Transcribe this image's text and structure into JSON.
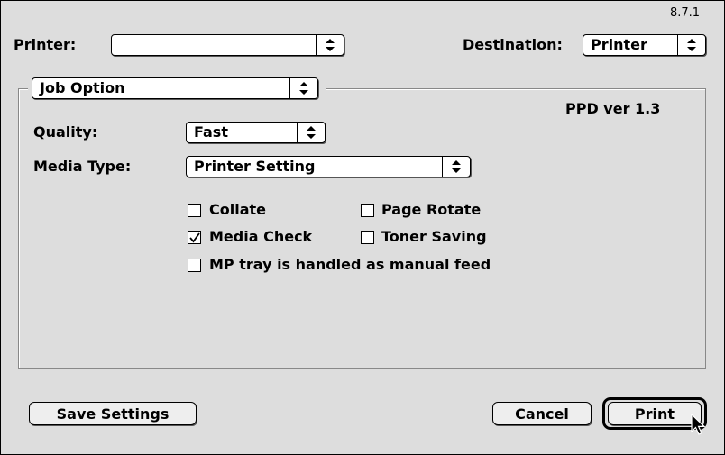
{
  "version": "8.7.1",
  "printer": {
    "label": "Printer:",
    "value": ""
  },
  "destination": {
    "label": "Destination:",
    "value": "Printer"
  },
  "panel": {
    "value": "Job Option"
  },
  "ppd_version": "PPD ver 1.3",
  "quality": {
    "label": "Quality:",
    "value": "Fast"
  },
  "media_type": {
    "label": "Media Type:",
    "value": "Printer Setting"
  },
  "options": {
    "collate": {
      "label": "Collate",
      "checked": false
    },
    "page_rotate": {
      "label": "Page Rotate",
      "checked": false
    },
    "media_check": {
      "label": "Media Check",
      "checked": true
    },
    "toner_saving": {
      "label": "Toner Saving",
      "checked": false
    },
    "mp_tray": {
      "label": "MP tray is handled as manual feed",
      "checked": false
    }
  },
  "buttons": {
    "save_settings": "Save Settings",
    "cancel": "Cancel",
    "print": "Print"
  }
}
